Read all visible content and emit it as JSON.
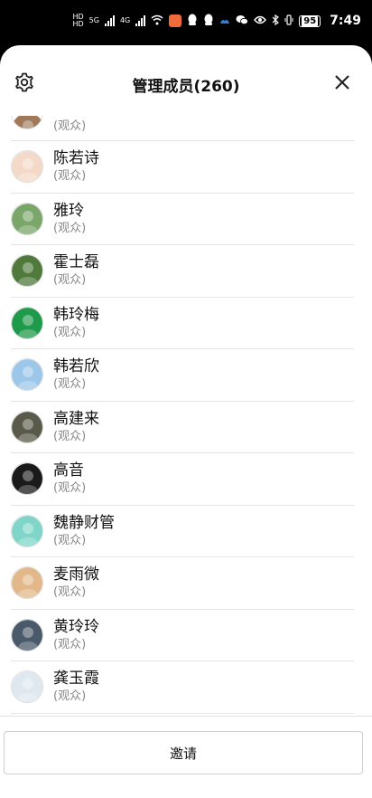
{
  "status_bar": {
    "time": "7:49",
    "battery": "95",
    "network_top": "HD",
    "network_bottom": "HD",
    "signal_1": "5G",
    "signal_2": "4G"
  },
  "header": {
    "title": "管理成员(260)",
    "settings_icon": "gear-icon",
    "close_icon": "close-icon"
  },
  "members": [
    {
      "name": "",
      "role": "(观众)",
      "avatar_color": "#a0785a",
      "partial": true
    },
    {
      "name": "陈若诗",
      "role": "(观众)",
      "avatar_color": "#f4d9c8"
    },
    {
      "name": "雅玲",
      "role": "(观众)",
      "avatar_color": "#7aa66a"
    },
    {
      "name": "霍士磊",
      "role": "(观众)",
      "avatar_color": "#4f7a3c"
    },
    {
      "name": "韩玲梅",
      "role": "(观众)",
      "avatar_color": "#1f9a4a"
    },
    {
      "name": "韩若欣",
      "role": "(观众)",
      "avatar_color": "#9cc7e8"
    },
    {
      "name": "高建来",
      "role": "(观众)",
      "avatar_color": "#5a5a4a"
    },
    {
      "name": "高音",
      "role": "(观众)",
      "avatar_color": "#1a1a1a"
    },
    {
      "name": "魏静财管",
      "role": "(观众)",
      "avatar_color": "#7fd6c8"
    },
    {
      "name": "麦雨微",
      "role": "(观众)",
      "avatar_color": "#e2b88a"
    },
    {
      "name": "黄玲玲",
      "role": "(观众)",
      "avatar_color": "#4a5a6a"
    },
    {
      "name": "龚玉霞",
      "role": "(观众)",
      "avatar_color": "#dfe8ef"
    }
  ],
  "invite_button": {
    "label": "邀请"
  }
}
